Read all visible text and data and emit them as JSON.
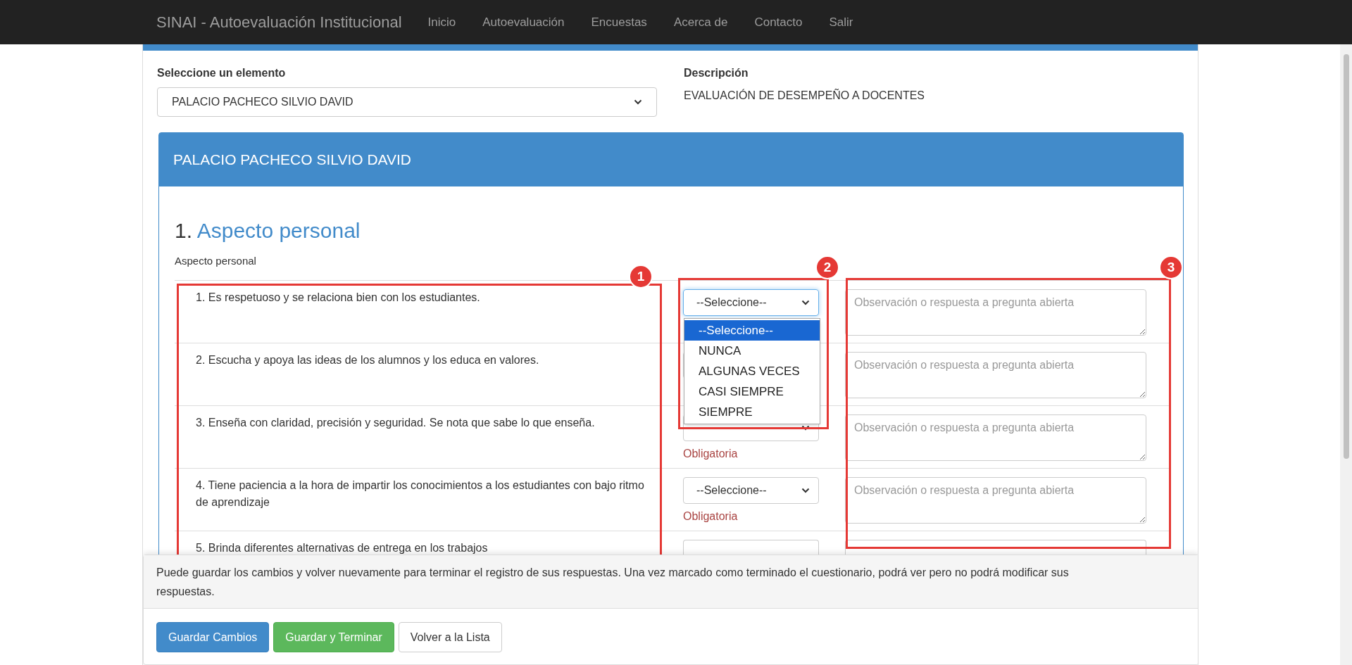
{
  "navbar": {
    "brand": "SINAI - Autoevaluación Institucional",
    "links": [
      "Inicio",
      "Autoevaluación",
      "Encuestas",
      "Acerca de",
      "Contacto",
      "Salir"
    ]
  },
  "element_select": {
    "label": "Seleccione un elemento",
    "value": "PALACIO PACHECO SILVIO DAVID"
  },
  "description": {
    "label": "Descripción",
    "text": "EVALUACIÓN DE DESEMPEÑO A DOCENTES"
  },
  "panel": {
    "title": "PALACIO PACHECO SILVIO DAVID",
    "section": {
      "number": "1.",
      "title": "Aspecto personal",
      "subtitle": "Aspecto personal"
    },
    "questions": [
      {
        "text": "1. Es respetuoso y se relaciona bien con los estudiantes.",
        "answer": "--Seleccione--",
        "focused": true,
        "observation_placeholder": "Observación o respuesta a pregunta abierta"
      },
      {
        "text": "2. Escucha y apoya las ideas de los alumnos y los educa en valores.",
        "observation_placeholder": "Observación o respuesta a pregunta abierta"
      },
      {
        "text": "3. Enseña con claridad, precisión y seguridad. Se nota que sabe lo que enseña.",
        "required_note": "Obligatoria",
        "observation_placeholder": "Observación o respuesta a pregunta abierta"
      },
      {
        "text": "4. Tiene paciencia a la hora de impartir los conocimientos a los estudiantes con bajo ritmo de aprendizaje",
        "answer": "--Seleccione--",
        "focused": false,
        "required_note": "Obligatoria",
        "observation_placeholder": "Observación o respuesta a pregunta abierta"
      },
      {
        "text": "5. Brinda diferentes alternativas de entrega en los trabajos"
      }
    ],
    "open_dropdown": {
      "options": [
        {
          "label": "--Seleccione--",
          "selected": true
        },
        {
          "label": "NUNCA",
          "selected": false
        },
        {
          "label": "ALGUNAS VECES",
          "selected": false
        },
        {
          "label": "CASI SIEMPRE",
          "selected": false
        },
        {
          "label": "SIEMPRE",
          "selected": false
        }
      ]
    }
  },
  "footer": {
    "note": "Puede guardar los cambios y volver nuevamente para terminar el registro de sus respuestas. Una vez marcado como terminado el cuestionario, podrá ver pero no podrá modificar sus respuestas.",
    "buttons": [
      {
        "label": "Guardar Cambios",
        "kind": "primary"
      },
      {
        "label": "Guardar y Terminar",
        "kind": "success"
      },
      {
        "label": "Volver a la Lista",
        "kind": "default"
      }
    ]
  },
  "annotations": [
    {
      "label": "1"
    },
    {
      "label": "2"
    },
    {
      "label": "3"
    }
  ]
}
